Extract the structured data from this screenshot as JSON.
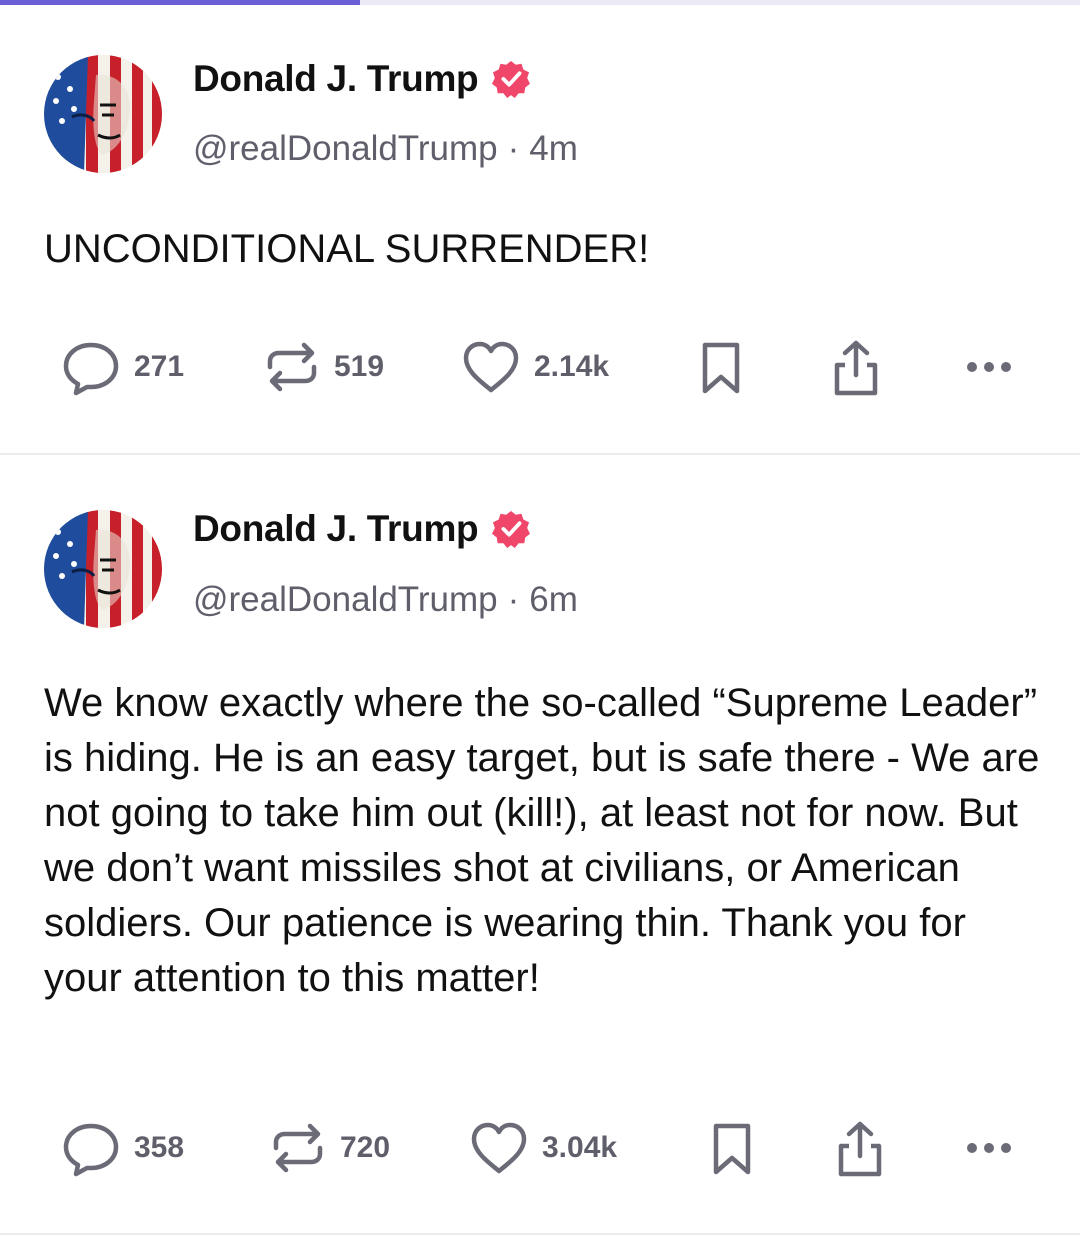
{
  "progress": {
    "fraction": 0.333,
    "fill_color": "#6b5fd6",
    "track_color": "#eceaf6"
  },
  "colors": {
    "verified_badge": "#f0466a",
    "icon": "#6b6b78"
  },
  "posts": [
    {
      "author_name": "Donald J. Trump",
      "verified": true,
      "handle": "@realDonaldTrump",
      "separator": "·",
      "time": "4m",
      "avatar": "avatar-flag-portrait",
      "text": "UNCONDITIONAL SURRENDER!",
      "actions": {
        "reply_count": "271",
        "repost_count": "519",
        "like_count": "2.14k",
        "icons": [
          "reply-icon",
          "repost-icon",
          "heart-icon",
          "bookmark-icon",
          "share-icon",
          "more-icon"
        ]
      }
    },
    {
      "author_name": "Donald J. Trump",
      "verified": true,
      "handle": "@realDonaldTrump",
      "separator": "·",
      "time": "6m",
      "avatar": "avatar-flag-portrait",
      "text": "We know exactly where the so-called “Supreme Leader” is hiding. He is an easy target, but is safe there - We are not going to take him out (kill!), at least not for now. But we don’t want missiles shot at civilians, or American soldiers. Our patience is wearing thin. Thank you for your attention to this matter!",
      "actions": {
        "reply_count": "358",
        "repost_count": "720",
        "like_count": "3.04k",
        "icons": [
          "reply-icon",
          "repost-icon",
          "heart-icon",
          "bookmark-icon",
          "share-icon",
          "more-icon"
        ]
      }
    }
  ]
}
